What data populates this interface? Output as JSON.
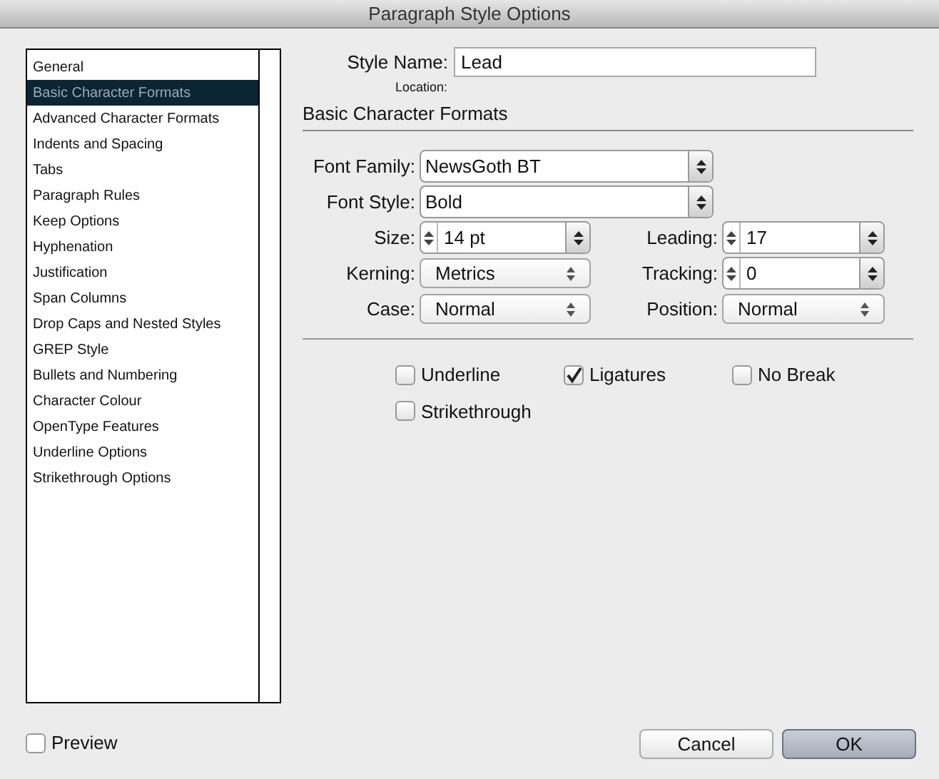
{
  "window": {
    "title": "Paragraph Style Options"
  },
  "sidebar": {
    "items": [
      {
        "label": "General",
        "selected": false
      },
      {
        "label": "Basic Character Formats",
        "selected": true
      },
      {
        "label": "Advanced Character Formats",
        "selected": false
      },
      {
        "label": "Indents and Spacing",
        "selected": false
      },
      {
        "label": "Tabs",
        "selected": false
      },
      {
        "label": "Paragraph Rules",
        "selected": false
      },
      {
        "label": "Keep Options",
        "selected": false
      },
      {
        "label": "Hyphenation",
        "selected": false
      },
      {
        "label": "Justification",
        "selected": false
      },
      {
        "label": "Span Columns",
        "selected": false
      },
      {
        "label": "Drop Caps and Nested Styles",
        "selected": false
      },
      {
        "label": "GREP Style",
        "selected": false
      },
      {
        "label": "Bullets and Numbering",
        "selected": false
      },
      {
        "label": "Character Colour",
        "selected": false
      },
      {
        "label": "OpenType Features",
        "selected": false
      },
      {
        "label": "Underline Options",
        "selected": false
      },
      {
        "label": "Strikethrough Options",
        "selected": false
      }
    ]
  },
  "style_name": {
    "label": "Style Name:",
    "value": "Lead"
  },
  "location": {
    "label": "Location:"
  },
  "section_title": "Basic Character Formats",
  "wide_fields": [
    {
      "label": "Font Family:",
      "value": "NewsGoth BT"
    },
    {
      "label": "Font Style:",
      "value": "Bold"
    }
  ],
  "field_rows": [
    [
      {
        "label": "Size:",
        "kind": "spin",
        "value": "14 pt"
      },
      {
        "label": "Leading:",
        "kind": "spin",
        "value": "17"
      }
    ],
    [
      {
        "label": "Kerning:",
        "kind": "select",
        "value": "Metrics"
      },
      {
        "label": "Tracking:",
        "kind": "spin",
        "value": "0"
      }
    ],
    [
      {
        "label": "Case:",
        "kind": "select",
        "value": "Normal"
      },
      {
        "label": "Position:",
        "kind": "select",
        "value": "Normal"
      }
    ]
  ],
  "checkboxes": [
    {
      "label": "Underline",
      "checked": false
    },
    {
      "label": "Ligatures",
      "checked": true
    },
    {
      "label": "No Break",
      "checked": false
    },
    {
      "label": "Strikethrough",
      "checked": false
    }
  ],
  "preview": {
    "label": "Preview",
    "checked": false
  },
  "buttons": [
    {
      "label": "Cancel",
      "default": false
    },
    {
      "label": "OK",
      "default": true
    }
  ]
}
